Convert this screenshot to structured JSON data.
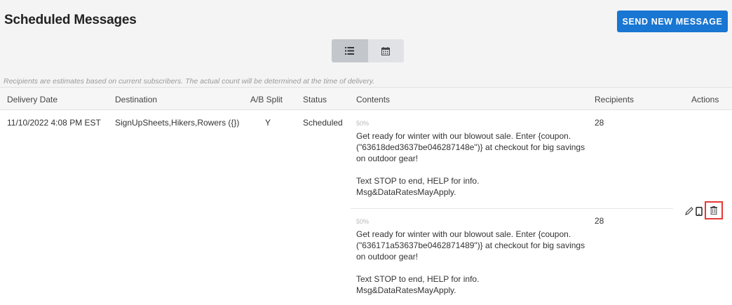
{
  "header": {
    "title": "Scheduled Messages",
    "send_button": "SEND NEW MESSAGE"
  },
  "view_toggle": [
    {
      "name": "list-view",
      "icon": "list-icon",
      "active": true
    },
    {
      "name": "calendar-view",
      "icon": "calendar-icon",
      "active": false
    }
  ],
  "note": "Recipients are estimates based on current subscribers. The actual count will be determined at the time of delivery.",
  "table": {
    "columns": {
      "delivery_date": "Delivery Date",
      "destination": "Destination",
      "ab_split": "A/B Split",
      "status": "Status",
      "contents": "Contents",
      "recipients": "Recipients",
      "actions": "Actions"
    },
    "row": {
      "delivery_date": "11/10/2022 4:08 PM EST",
      "destination": "SignUpSheets,Hikers,Rowers ({})",
      "ab_split": "Y",
      "status": "Scheduled",
      "variants": [
        {
          "split": "50%",
          "text": "Get ready for winter with our blowout sale. Enter {coupon.(\"63618ded3637be046287148e\")} at checkout for big savings on outdoor gear!",
          "footer": "Text STOP to end, HELP for info. Msg&DataRatesMayApply.",
          "recipients": "28"
        },
        {
          "split": "50%",
          "text": "Get ready for winter with our blowout sale. Enter {coupon.(\"636171a53637be0462871489\")} at checkout for big savings on outdoor gear!",
          "footer": "Text STOP to end, HELP for info. Msg&DataRatesMayApply.",
          "recipients": "28"
        }
      ],
      "actions": [
        "edit-icon",
        "phone-preview-icon",
        "delete-icon"
      ]
    }
  },
  "colors": {
    "accent": "#1976d2",
    "highlight": "#e53935"
  }
}
